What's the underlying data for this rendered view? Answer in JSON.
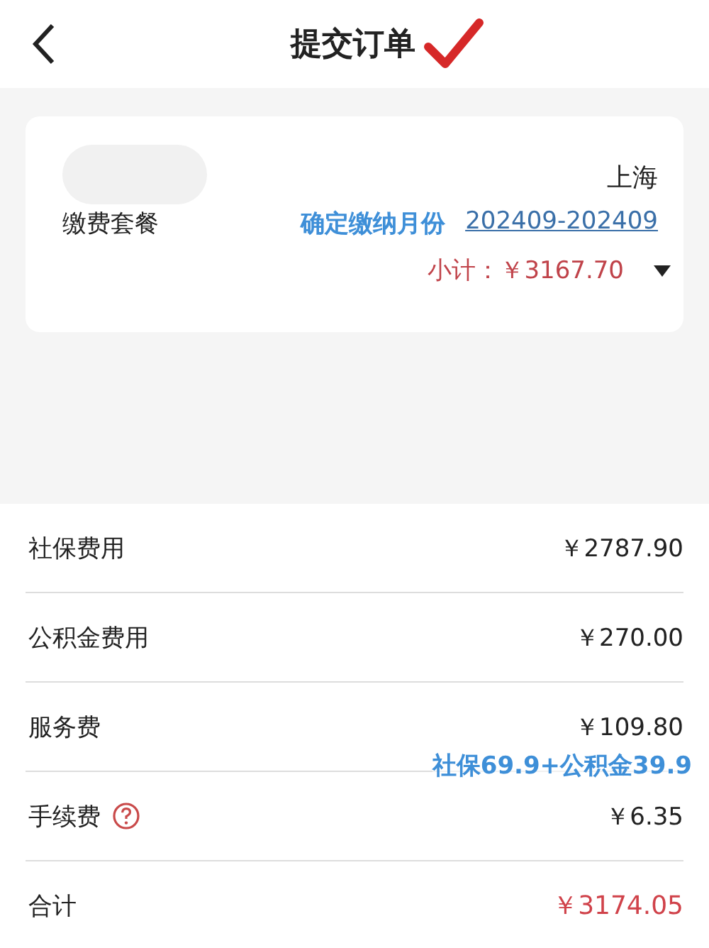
{
  "header": {
    "title": "提交订单"
  },
  "package_card": {
    "city": "上海",
    "label": "缴费套餐",
    "month_label": "确定缴纳月份",
    "month_range": "202409-202409",
    "subtotal": "小计：￥3167.70",
    "expanded": false
  },
  "fees": [
    {
      "kind": "fee",
      "label": "社保费用",
      "amount": "￥2787.90"
    },
    {
      "kind": "fee",
      "label": "公积金费用",
      "amount": "￥270.00"
    },
    {
      "kind": "fee",
      "label": "服务费",
      "amount": "￥109.80",
      "note": "社保69.9+公积金39.9"
    },
    {
      "kind": "fee-help",
      "label": "手续费",
      "amount": "￥6.35"
    },
    {
      "kind": "total",
      "label": "合计",
      "amount": "￥3174.05"
    }
  ]
}
